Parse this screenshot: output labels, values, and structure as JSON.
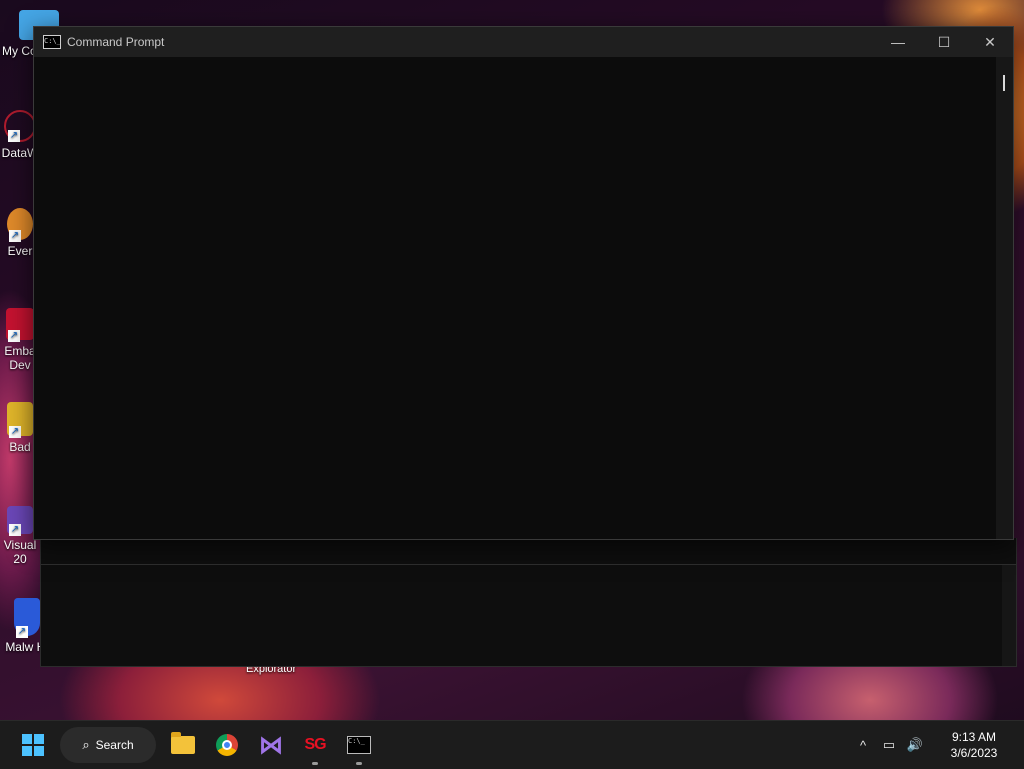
{
  "desktop": {
    "icons": [
      {
        "label": "My Co",
        "icon": "computer-icon",
        "color": "#45a6e6"
      },
      {
        "label": "DataW",
        "icon": "datawarehouse-icon",
        "color": "#b01c2e"
      },
      {
        "label": "Ever",
        "icon": "everything-icon",
        "color": "#e08a2a"
      },
      {
        "label": "Emba Dev",
        "icon": "embarcadero-icon",
        "color": "#c41230"
      },
      {
        "label": "Bad",
        "icon": "bad-app-icon",
        "color": "#e0b52a"
      },
      {
        "label": "Visual 20",
        "icon": "visual-studio-icon",
        "color": "#6b47b8"
      },
      {
        "label": "Malw Hunter",
        "icon": "shield-icon",
        "color": "#2a5ad8"
      }
    ],
    "extra_label": "Explorator"
  },
  "cmd_window": {
    "title": "Command Prompt",
    "icon": "cmd-icon",
    "minimize": "—",
    "maximize": "☐",
    "close": "✕"
  },
  "taskbar": {
    "search_label": "Search",
    "apps": [
      {
        "name": "file-explorer",
        "running": false
      },
      {
        "name": "chrome",
        "running": false
      },
      {
        "name": "visual-studio",
        "running": false
      },
      {
        "name": "sg",
        "label": "SG",
        "running": true
      },
      {
        "name": "command-prompt",
        "running": true
      }
    ],
    "tray": {
      "chevron": "^",
      "network": "▭",
      "volume": "🔊",
      "time": "9:13 AM",
      "date": "3/6/2023"
    }
  },
  "colors": {
    "accent": "#4cc2ff",
    "window_bg": "#0c0c0c",
    "titlebar_bg": "#1f1f1f",
    "taskbar_bg": "#1c1c1c"
  }
}
